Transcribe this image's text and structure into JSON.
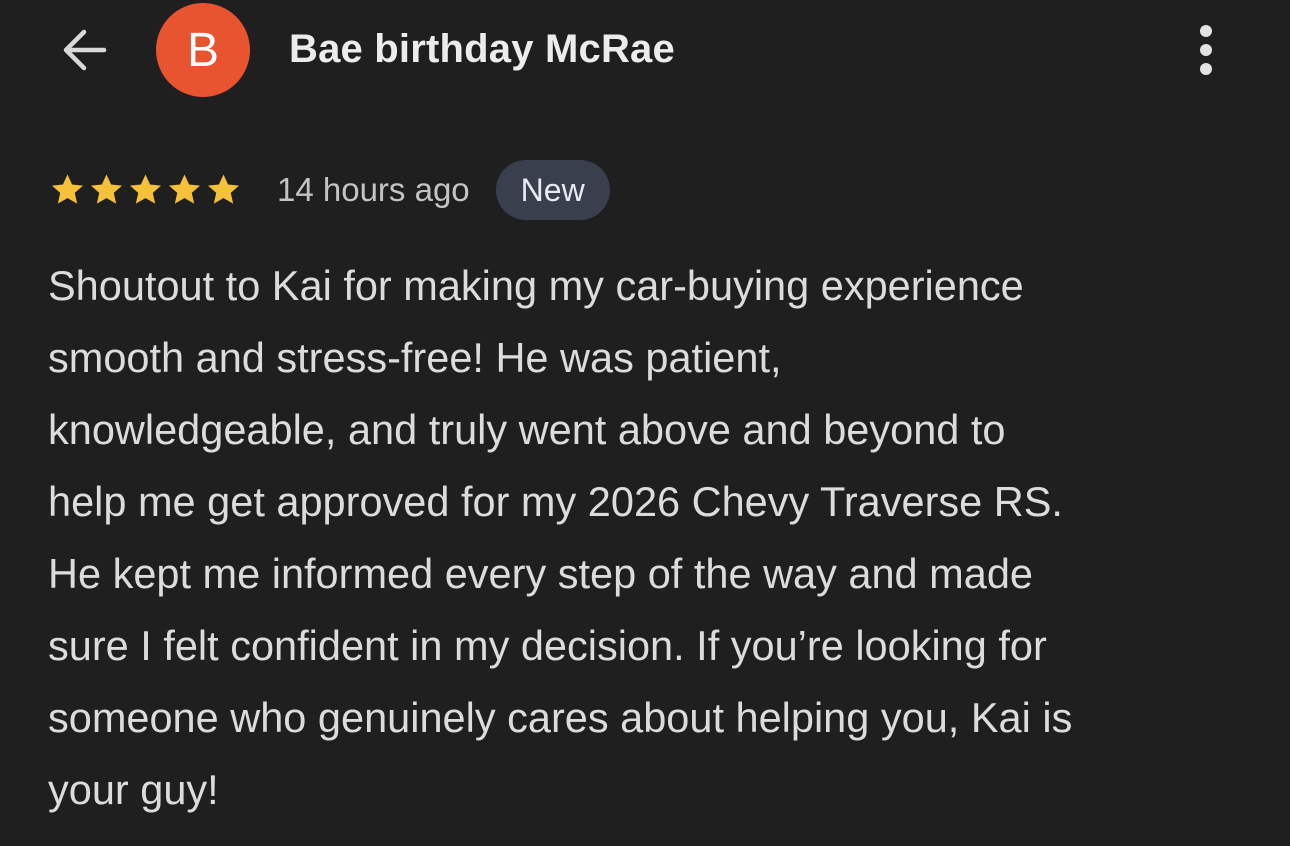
{
  "header": {
    "back_icon": "arrow-left-icon",
    "avatar_letter": "B",
    "avatar_color": "#e8542f",
    "reviewer_name": "Bae birthday McRae",
    "more_icon": "more-vertical-icon"
  },
  "review": {
    "rating": 5,
    "rating_max": 5,
    "star_color": "#f5c13b",
    "time_ago": "14 hours ago",
    "badge": "New",
    "text": "Shoutout to Kai for making my car-buying experience\nsmooth and stress-free! He was patient,\nknowledgeable, and truly went above and beyond to\nhelp me get approved for my 2026 Chevy Traverse RS.\nHe kept me informed every step of the way and made\nsure I felt confident in my decision. If you’re looking for\nsomeone who genuinely cares about helping you, Kai is\nyour guy!"
  }
}
